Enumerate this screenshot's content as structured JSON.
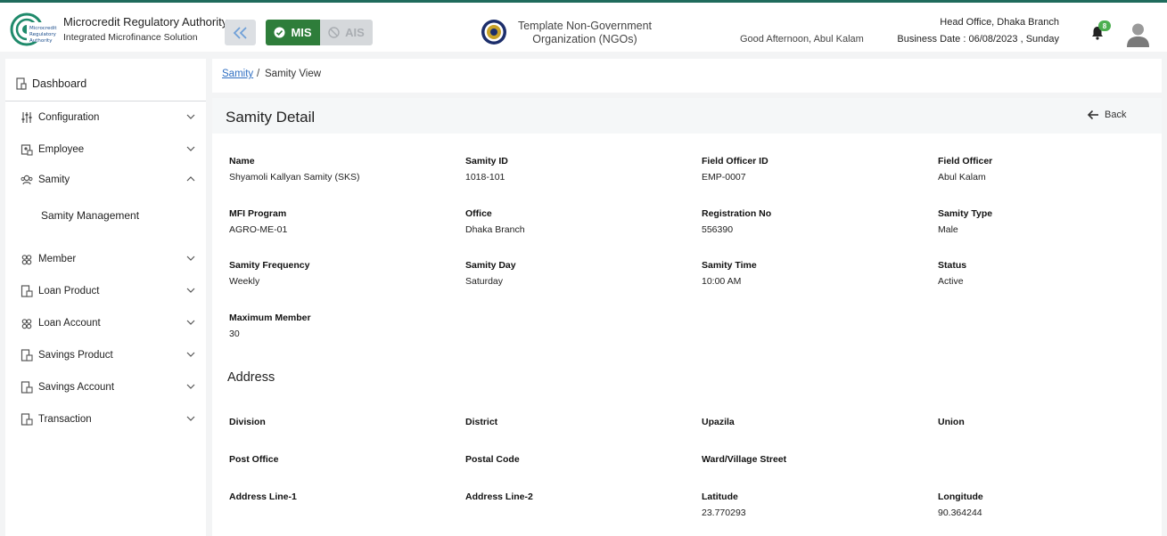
{
  "header": {
    "org_title": "Microcredit Regulatory Authority",
    "org_subtitle": "Integrated Microfinance Solution",
    "logo_text": [
      "Microcredit",
      "Regulatory",
      "Authority"
    ],
    "mode_mis": "MIS",
    "mode_ais": "AIS",
    "ngo_name_line1": "Template Non-Government",
    "ngo_name_line2": "Organization (NGOs)",
    "greeting": "Good Afternoon, Abul Kalam",
    "branch": "Head Office, Dhaka Branch",
    "business_date": "Business Date : 06/08/2023 , Sunday",
    "notification_count": "8",
    "colors": {
      "brand": "#1f6b5c",
      "mis_active": "#2e7d3a",
      "badge": "#4caf50"
    }
  },
  "sidebar": {
    "dashboard": "Dashboard",
    "items": [
      {
        "label": "Configuration",
        "icon": "sliders-icon",
        "expanded": false
      },
      {
        "label": "Employee",
        "icon": "id-card-icon",
        "expanded": false
      },
      {
        "label": "Samity",
        "icon": "group-icon",
        "expanded": true
      },
      {
        "label": "Member",
        "icon": "users-icon",
        "expanded": false
      },
      {
        "label": "Loan Product",
        "icon": "document-icon",
        "expanded": false
      },
      {
        "label": "Loan Account",
        "icon": "users-icon",
        "expanded": false
      },
      {
        "label": "Savings Product",
        "icon": "document-icon",
        "expanded": false
      },
      {
        "label": "Savings Account",
        "icon": "document-icon",
        "expanded": false
      },
      {
        "label": "Transaction",
        "icon": "document-icon",
        "expanded": false
      }
    ],
    "samity_sub": "Samity Management"
  },
  "breadcrumb": {
    "link": "Samity",
    "sep": "/",
    "current": "Samity View"
  },
  "panel": {
    "title": "Samity Detail",
    "back": "Back",
    "fields": [
      {
        "label": "Name",
        "value": "Shyamoli Kallyan Samity (SKS)"
      },
      {
        "label": "Samity ID",
        "value": "1018-101"
      },
      {
        "label": "Field Officer ID",
        "value": "EMP-0007"
      },
      {
        "label": "Field Officer",
        "value": "Abul Kalam"
      },
      {
        "label": "MFI Program",
        "value": "AGRO-ME-01"
      },
      {
        "label": "Office",
        "value": "Dhaka Branch"
      },
      {
        "label": "Registration No",
        "value": "556390"
      },
      {
        "label": "Samity Type",
        "value": "Male"
      },
      {
        "label": "Samity Frequency",
        "value": "Weekly"
      },
      {
        "label": "Samity Day",
        "value": "Saturday"
      },
      {
        "label": "Samity Time",
        "value": "10:00 AM"
      },
      {
        "label": "Status",
        "value": "Active"
      },
      {
        "label": "Maximum Member",
        "value": "30"
      }
    ],
    "address_title": "Address",
    "address_fields": [
      {
        "label": "Division",
        "value": ""
      },
      {
        "label": "District",
        "value": ""
      },
      {
        "label": "Upazila",
        "value": ""
      },
      {
        "label": "Union",
        "value": ""
      },
      {
        "label": "Post Office",
        "value": ""
      },
      {
        "label": "Postal Code",
        "value": ""
      },
      {
        "label": "Ward/Village Street",
        "value": ""
      },
      {
        "label": "Address Line-1",
        "value": ""
      },
      {
        "label": "Address Line-2",
        "value": ""
      },
      {
        "label": "Latitude",
        "value": "23.770293"
      },
      {
        "label": "Longitude",
        "value": "90.364244"
      }
    ]
  }
}
